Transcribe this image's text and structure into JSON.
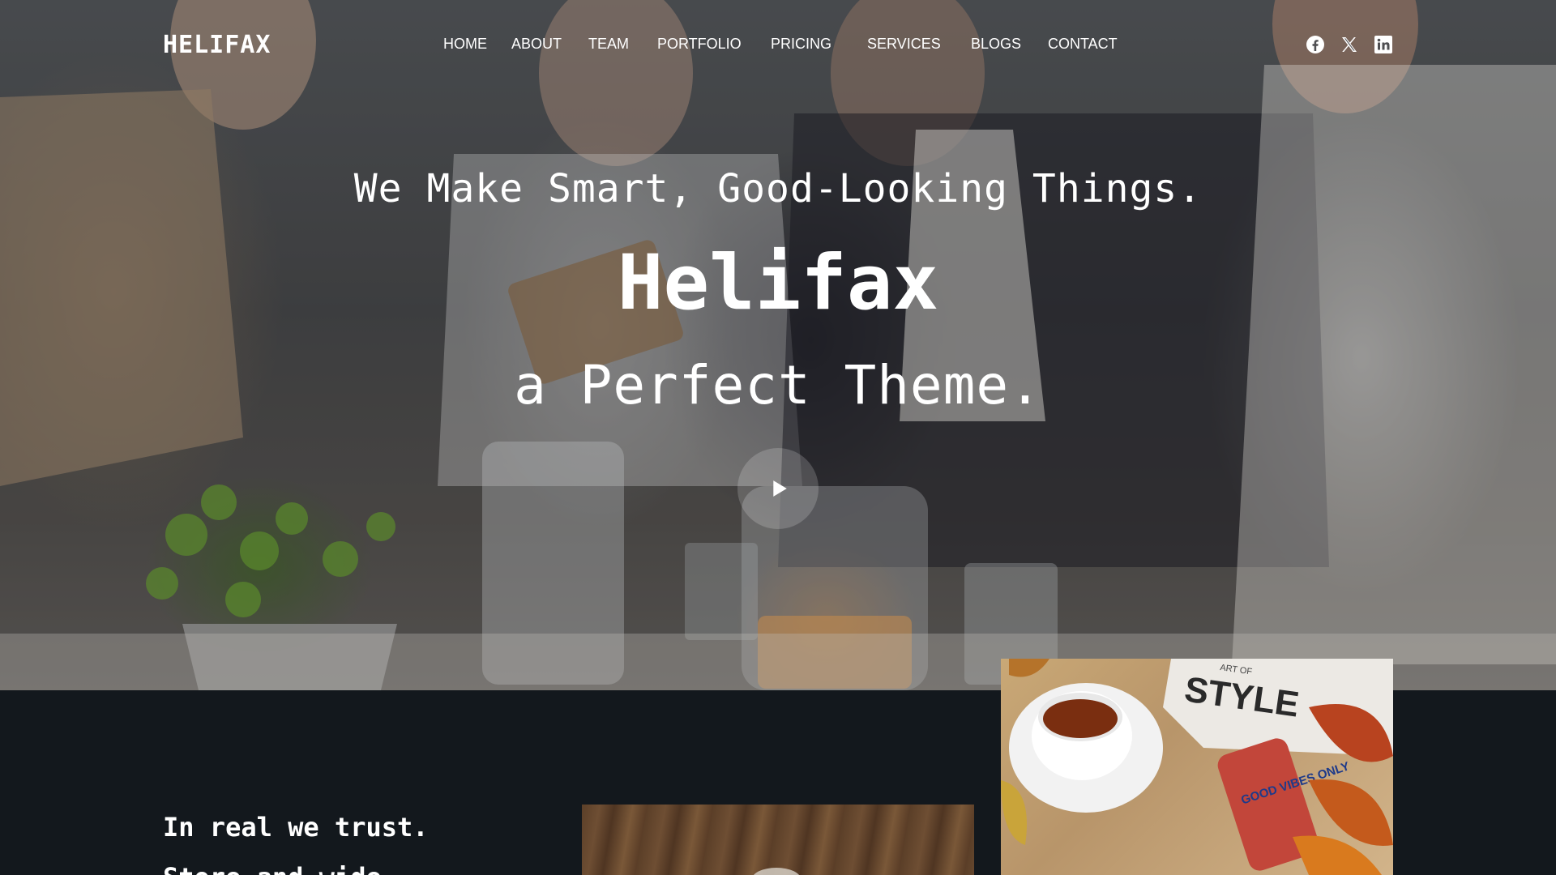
{
  "brand": {
    "logo": "HELIFAX"
  },
  "nav": {
    "items": [
      {
        "label": "HOME"
      },
      {
        "label": "ABOUT"
      },
      {
        "label": "TEAM"
      },
      {
        "label": "PORTFOLIO"
      },
      {
        "label": "PRICING"
      },
      {
        "label": "SERVICES"
      },
      {
        "label": "BLOGS"
      },
      {
        "label": "CONTACT"
      }
    ]
  },
  "social": [
    {
      "icon": "facebook-icon"
    },
    {
      "icon": "x-twitter-icon"
    },
    {
      "icon": "linkedin-icon"
    }
  ],
  "hero": {
    "tagline": "We Make Smart, Good-Looking Things.",
    "title": "Helifax",
    "subtitle": "a Perfect Theme.",
    "play_icon": "play-icon"
  },
  "section": {
    "heading": "In real we trust.",
    "line2": "Store and wide"
  },
  "photos": {
    "tea_magazine": {
      "magazine_text": "STYLE",
      "magazine_small": "ART OF",
      "phone_text": "GOOD VIBES ONLY"
    }
  },
  "colors": {
    "dark_bg": "#13181d",
    "text": "#ffffff"
  }
}
